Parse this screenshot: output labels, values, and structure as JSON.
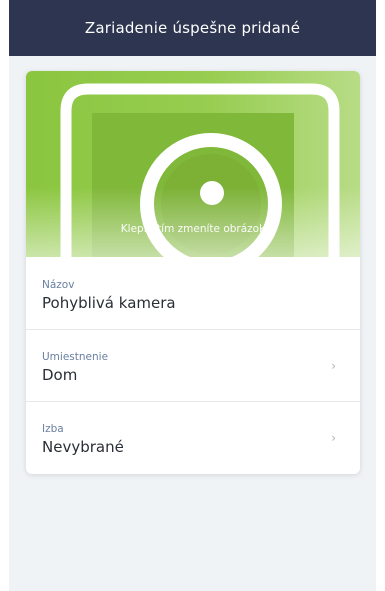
{
  "header": {
    "title": "Zariadenie úspešne pridané"
  },
  "hero": {
    "caption": "Klepnutím zmeníte obrázok",
    "icon": "camera-device-icon"
  },
  "fields": {
    "name": {
      "label": "Názov",
      "value": "Pohyblivá kamera"
    },
    "location": {
      "label": "Umiestnenie",
      "value": "Dom",
      "chevron": "›"
    },
    "room": {
      "label": "Izba",
      "value": "Nevybrané",
      "chevron": "›"
    }
  },
  "colors": {
    "navbar": "#2d3550",
    "hero_green": "#8bc63f",
    "label": "#6a7fa1",
    "background": "#f0f3f6"
  }
}
